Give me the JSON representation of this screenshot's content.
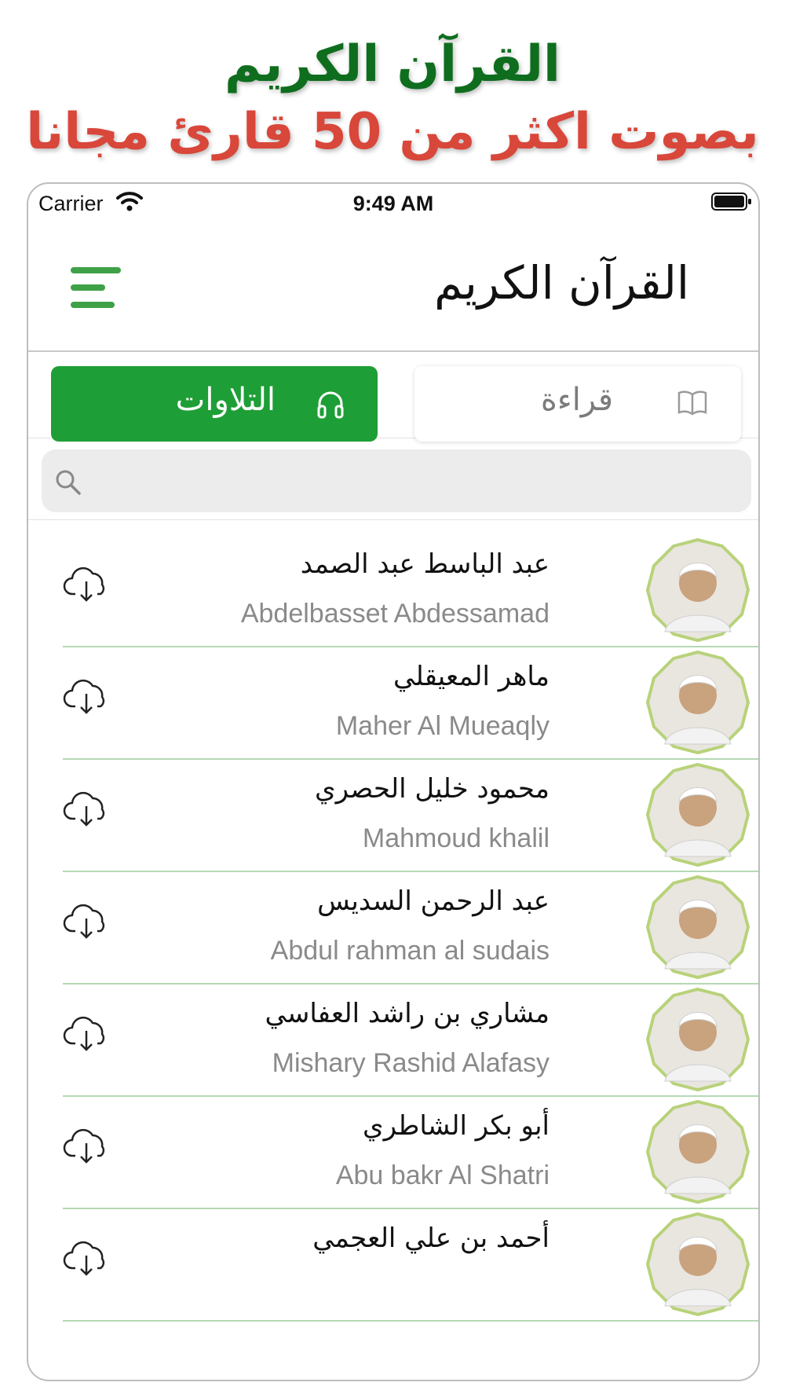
{
  "promo": {
    "title": "القرآن الكريم",
    "subtitle": "بصوت اكثر من 50 قارئ مجانا"
  },
  "status_bar": {
    "carrier": "Carrier",
    "time": "9:49 AM"
  },
  "navbar": {
    "title": "القرآن الكريم",
    "menu_icon": "hamburger-menu-icon"
  },
  "segments": {
    "listen_label": "التلاوات",
    "read_label": "قراءة",
    "selected": "listen"
  },
  "search": {
    "placeholder": ""
  },
  "reciters": [
    {
      "name_ar": "عبد الباسط عبد الصمد",
      "name_en": "Abdelbasset Abdessamad"
    },
    {
      "name_ar": "ماهر المعيقلي",
      "name_en": "Maher Al Mueaqly"
    },
    {
      "name_ar": "محمود خليل الحصري",
      "name_en": "Mahmoud khalil"
    },
    {
      "name_ar": "عبد الرحمن السديس",
      "name_en": "Abdul rahman al sudais"
    },
    {
      "name_ar": "مشاري بن راشد العفاسي",
      "name_en": "Mishary Rashid Alafasy"
    },
    {
      "name_ar": "أبو بكر الشاطري",
      "name_en": "Abu bakr Al Shatri"
    },
    {
      "name_ar": "أحمد بن علي العجمي",
      "name_en": ""
    }
  ],
  "colors": {
    "accent_green": "#1e9e36",
    "promo_title": "#0f6d1e",
    "promo_subtitle": "#d8473a",
    "avatar_border": "#b8d27a",
    "divider": "#b6d9b4"
  }
}
